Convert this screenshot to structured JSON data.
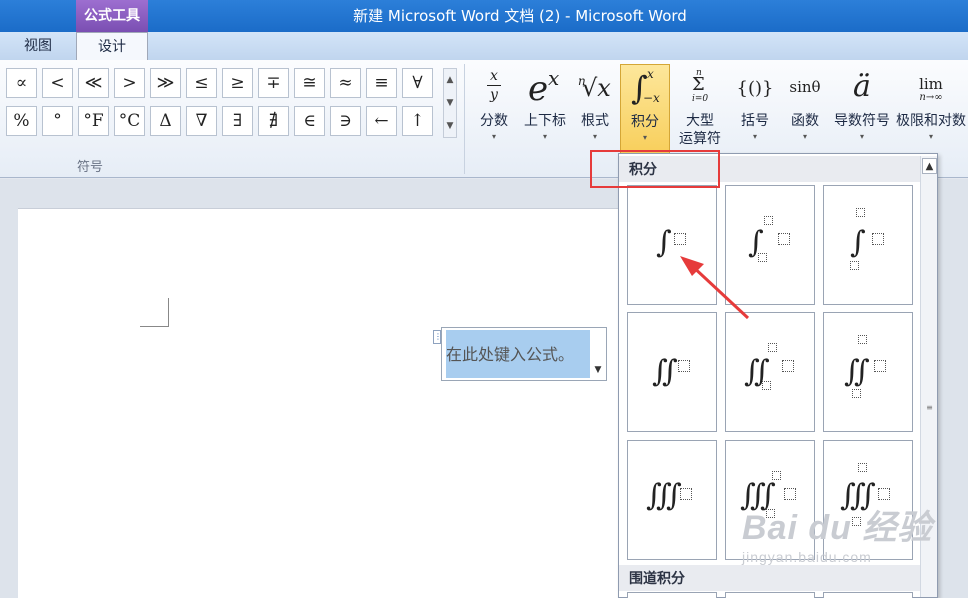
{
  "titlebar": {
    "context_group": "公式工具",
    "title": "新建 Microsoft Word 文档 (2) - Microsoft Word"
  },
  "tabs": {
    "view": "视图",
    "design": "设计"
  },
  "symbols": {
    "row1": [
      "∝",
      "<",
      "≪",
      ">",
      "≫",
      "≤",
      "≥",
      "∓",
      "≅",
      "≈",
      "≡",
      "∀"
    ],
    "row2": [
      "%",
      "°",
      "°F",
      "°C",
      "Δ",
      "∇",
      "∃",
      "∄",
      "∈",
      "∋",
      "←",
      "↑"
    ],
    "scroll": [
      "▲",
      "▼",
      "▼"
    ],
    "group_label": "符号"
  },
  "ribbon_buttons": [
    {
      "label": "分数",
      "label2": "",
      "glyph": "fraction"
    },
    {
      "label": "上下标",
      "label2": "",
      "glyph": "eˣ"
    },
    {
      "label": "根式",
      "label2": "",
      "glyph": "ⁿ√x"
    },
    {
      "label": "积分",
      "label2": "",
      "glyph": "∫"
    },
    {
      "label": "大型",
      "label2": "运算符",
      "glyph": "Σ"
    },
    {
      "label": "括号",
      "label2": "",
      "glyph": "{()}"
    },
    {
      "label": "函数",
      "label2": "",
      "glyph": "sinθ"
    },
    {
      "label": "导数符号",
      "label2": "",
      "glyph": "ä"
    },
    {
      "label": "极限和对数",
      "label2": "",
      "glyph": "lim"
    }
  ],
  "glyph_text": {
    "frac_num": "x",
    "frac_den": "y",
    "e": "e",
    "e_sup": "x",
    "root_n": "n",
    "root": "√x",
    "int_sign": "∫",
    "int_upper": "x",
    "int_lower": "−x",
    "sum_top": "n",
    "sum_sign": "Σ",
    "sum_bot": "i=0",
    "bracket": "{()}",
    "func": "sinθ",
    "deriv": "ä",
    "lim": "lim",
    "lim_sub": "n→∞"
  },
  "caret": "▾",
  "equation": {
    "placeholder": "在此处键入公式。",
    "handle": "⋮",
    "menu": "▼"
  },
  "gallery": {
    "section1": "积分",
    "section2": "围道积分",
    "int_single": "∫",
    "int_double": "∬",
    "int_triple": "∭",
    "scroll_up": "▲",
    "grip": "≡"
  },
  "watermark": {
    "logo": "Bai du 经验",
    "url": "jingyan.baidu.com"
  },
  "colors": {
    "accent": "#f8cf5c",
    "annotation": "#e63b3b",
    "selection": "#a8cdef"
  }
}
